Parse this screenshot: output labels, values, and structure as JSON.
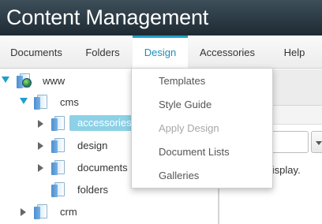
{
  "header": {
    "title": "Content Management"
  },
  "nav": {
    "items": [
      {
        "label": "Documents"
      },
      {
        "label": "Folders"
      },
      {
        "label": "Design",
        "active": true
      },
      {
        "label": "Accessories"
      },
      {
        "label": "Help"
      }
    ]
  },
  "design_menu": {
    "items": [
      {
        "label": "Templates",
        "enabled": true
      },
      {
        "label": "Style Guide",
        "enabled": true
      },
      {
        "label": "Apply Design",
        "enabled": false
      },
      {
        "label": "Document Lists",
        "enabled": true
      },
      {
        "label": "Galleries",
        "enabled": true
      }
    ]
  },
  "tree": {
    "root": {
      "label": "www",
      "expanded": true
    },
    "nodes": [
      {
        "label": "cms",
        "expanded": true
      },
      {
        "label": "accessories",
        "selected": true
      },
      {
        "label": "design"
      },
      {
        "label": "documents"
      },
      {
        "label": "folders"
      },
      {
        "label": "crm"
      }
    ]
  },
  "right_pane": {
    "message": "s to display."
  },
  "colors": {
    "accent": "#20a0c8",
    "selected_bg": "#8dd1e6",
    "header_bg": "#2b3a44"
  }
}
